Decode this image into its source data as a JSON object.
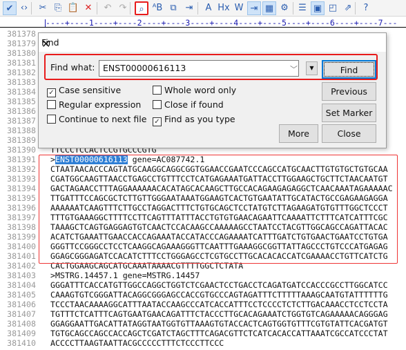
{
  "toolbar": {
    "icons": [
      "spellcheck-icon",
      "html-tag-icon",
      "cut-icon",
      "copy-icon",
      "paste-icon",
      "delete-icon",
      "undo-icon",
      "redo-icon",
      "find-icon",
      "replace-icon",
      "find-in-files-icon",
      "goto-line-icon",
      "font-icon",
      "hex-icon",
      "word-wrap-icon",
      "line-numbers-icon",
      "column-mode-icon",
      "settings-icon",
      "list-icon",
      "panel-icon",
      "browser-icon",
      "export-icon",
      "help-icon"
    ],
    "active": "find-icon"
  },
  "ruler": {
    "text": "----+----1----+----2----+----3----+----4----+----5----+----6----+----7---"
  },
  "editor": {
    "lines": [
      {
        "n": "381378",
        "t": ""
      },
      {
        "n": "381379",
        "t": ""
      },
      {
        "n": "381380",
        "t": ""
      },
      {
        "n": "381381",
        "t": ""
      },
      {
        "n": "381382",
        "t": ""
      },
      {
        "n": "381383",
        "t": ""
      },
      {
        "n": "381384",
        "t": ""
      },
      {
        "n": "381385",
        "t": ""
      },
      {
        "n": "381386",
        "t": ""
      },
      {
        "n": "381387",
        "t": ""
      },
      {
        "n": "381388",
        "t": ""
      },
      {
        "n": "381389",
        "t": ""
      },
      {
        "n": "381390",
        "t": "TTCCCTCCACTCCGTGCCCGTG"
      },
      {
        "n": "381391",
        "pre": ">",
        "match": "ENST00000616113",
        "t": " gene=AC087742.1"
      },
      {
        "n": "381392",
        "t": "CTAATAACACCCAGTATGCAAGGCAGGCGGTGGAACCGAATCCCAGCCATGCAACTTGTGTGCTGTGCAA"
      },
      {
        "n": "381393",
        "t": "CGATGGCAAGTTAACCTGAGCCTGTTTCCTCATGAGAAATGATTACCTTGGAAGCTGCTTCTAACAATGT"
      },
      {
        "n": "381394",
        "t": "GACTAGAACCTTTAGGAAAAAACACATAGCACAAGCTTGCCACAGAAGAGAGGCTCAACAAATAGAAAAAC"
      },
      {
        "n": "381395",
        "t": "TTGATTTCCAGCGCTCTTGTTGGGAATAAATGGAAGTCACTGTGAATATTGCATACTGCCGAGAAGAGGA"
      },
      {
        "n": "381396",
        "t": "AAAAAATCAAGTTTCTTGCCTAGGACTTTCTGTGCAGCTCCTATGTCTTAGAAGATGTGTTTGGCTCCCT"
      },
      {
        "n": "381397",
        "t": "TTTGTGAAAGGCTTTTCCTTCAGTTTATTTACCTGTGTGAACAGAATTCAAAATTCTTTCATCATTTCGC"
      },
      {
        "n": "381398",
        "t": "TAAAGCTCAGTGAGGAGTGTCAACTCCACAAGCCAAAAAGCCTAATCCTACGTTGGCAGCCAGATTACAC"
      },
      {
        "n": "381399",
        "t": "ACATCTGAAATTGAACCACCAGAAATACCATACCCAGAAAATCATTTGATCTGTGAACTGAATCCTGTGA"
      },
      {
        "n": "381400",
        "t": "GGGTTCCGGGCCTCCTCAAGGCAGAAAGGGTTCAATTTGAAAGGCGGTTATTAGCCCTGTCCCATGAGAG"
      },
      {
        "n": "381401",
        "t": "GGAGCGGGAGATCCACATCTTTCCTGGGAGCCTCGTGCCTTGCACACACCATCGAAAACCTGTTCATCTG"
      },
      {
        "n": "381402",
        "t": "CACTGGAAGCAGCATGCAAATAAAACGTTTTGGCTCTATA"
      },
      {
        "n": "381403",
        "t": ">MSTRG.14457.1 gene=MSTRG.14457"
      },
      {
        "n": "381404",
        "t": "GGGATTTCACCATGTTGGCCAGGCTGGTCTCGAACTCCTGACCTCAGATGATCCACCCGCCTTGGCATCC"
      },
      {
        "n": "381405",
        "t": "CAAAGTGTCGGGATTACAGGCGGGAGCCACCGTGCCCAGTAGATTTCTTTTTAAAGCAATGTATTTTTTG"
      },
      {
        "n": "381406",
        "t": "TCCCTAACAAAAGGCATTTAATACCAAGCCCATCACCATTTCCTCCCCTCTCTTGACAAACCTCCTCCTA"
      },
      {
        "n": "381407",
        "t": "TGTTTCTCATTTCAGTGAATGAACAGATTTCTACCCTTGCACAGAAATCTGGTGTCAGAAAAACAGGGAG"
      },
      {
        "n": "381408",
        "t": "GGAGGAATTGACATTATAGGTAATGGTGTTAAAGTGTACCACTCAGTGGTGTTTCGTGTATTCACGATGT"
      },
      {
        "n": "381409",
        "t": "TGTGCAGCCAGCCACCAGCTCGATCTAGCTTTCAGACGTTCTCATCACACCATTAAATCGCCATCCCTAT"
      },
      {
        "n": "381410",
        "t": "ACCCCTTAAGTAATTACGCCCCCTTTCTCCCTTCCC"
      }
    ]
  },
  "dialog": {
    "title": "Find",
    "find_what_label": "Find what:",
    "find_what_value": "ENST00000616113",
    "options": [
      {
        "label": "Case sensitive",
        "checked": true
      },
      {
        "label": "Regular expression",
        "checked": false
      },
      {
        "label": "Continue to next file",
        "checked": false
      },
      {
        "label": "Whole word only",
        "checked": false
      },
      {
        "label": "Close if found",
        "checked": false
      },
      {
        "label": "Find as you type",
        "checked": true
      }
    ],
    "buttons": {
      "find": "Find",
      "previous": "Previous",
      "set_marker": "Set Marker",
      "more": "More",
      "close": "Close"
    }
  },
  "colors": {
    "highlight": "#e81b1b",
    "selection": "#2f7fd5"
  }
}
